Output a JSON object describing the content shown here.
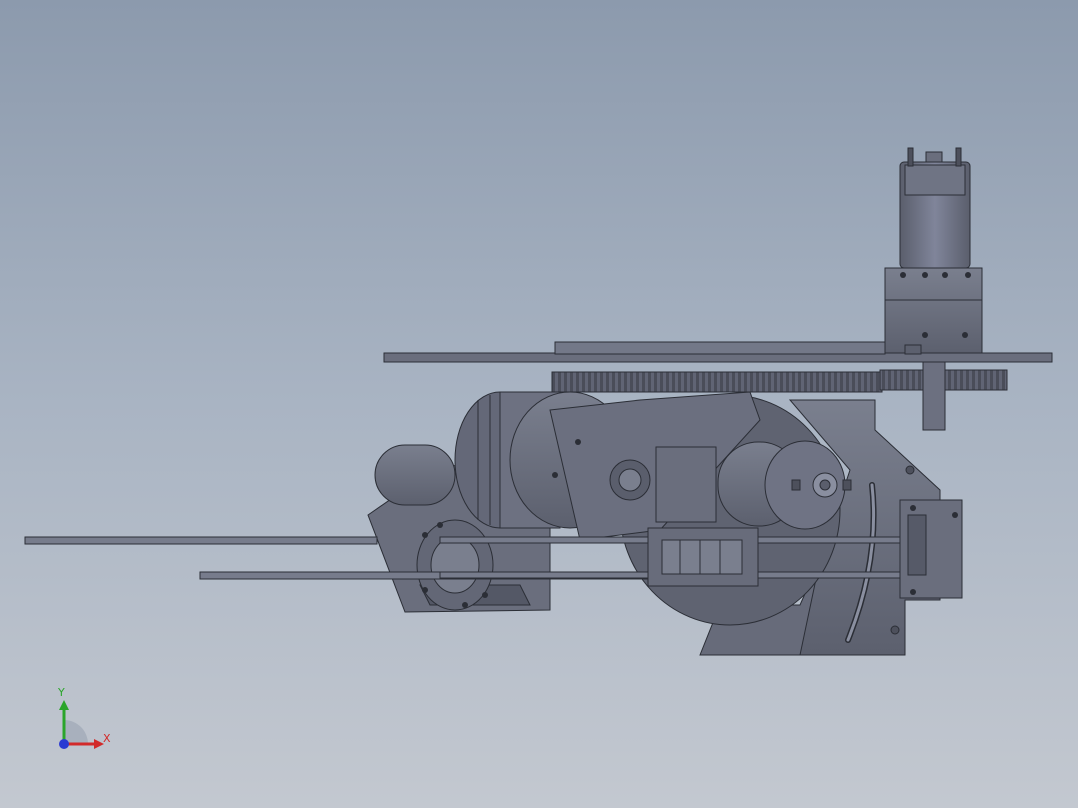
{
  "viewport": {
    "background_top": "#8c9aad",
    "background_bottom": "#c3c8d0",
    "model_color": "#6b7080",
    "model_shade": "#565a68",
    "edge_color": "#2b2e36"
  },
  "triad": {
    "x_label": "X",
    "y_label": "Y",
    "x_color": "#d22a2a",
    "y_color": "#2aa52a",
    "z_color": "#2a3ad2"
  },
  "model": {
    "parts": [
      "top-motor",
      "motor-flange",
      "top-plate",
      "ring-gear",
      "pinion-gear",
      "main-drum",
      "side-motor",
      "left-housing",
      "bearing-flange",
      "guide-rods",
      "linear-carriage",
      "curved-bracket",
      "connector-block",
      "base-plate"
    ]
  }
}
